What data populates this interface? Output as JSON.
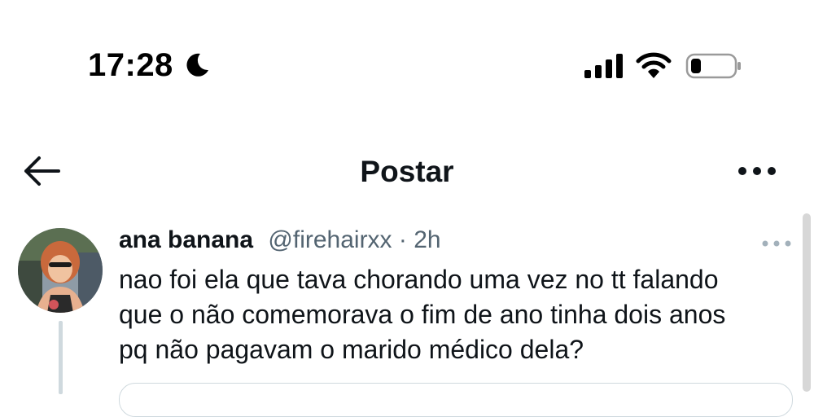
{
  "status_bar": {
    "time": "17:28",
    "icons": [
      "moon-icon",
      "cellular-signal-icon",
      "wifi-icon",
      "battery-icon"
    ]
  },
  "header": {
    "title": "Postar",
    "icons": [
      "back-arrow-icon",
      "more-options-icon"
    ]
  },
  "tweet": {
    "author_name": "ana banana",
    "author_handle": "@firehairxx",
    "separator": "·",
    "timestamp": "2h",
    "text": "nao foi ela que tava chorando uma vez no tt falando\nque o não comemorava o fim de ano tinha dois anos\npq não pagavam o marido médico dela?"
  },
  "colors": {
    "text_primary": "#0f1419",
    "text_secondary": "#536471",
    "divider": "#cfd9de",
    "background": "#ffffff"
  }
}
